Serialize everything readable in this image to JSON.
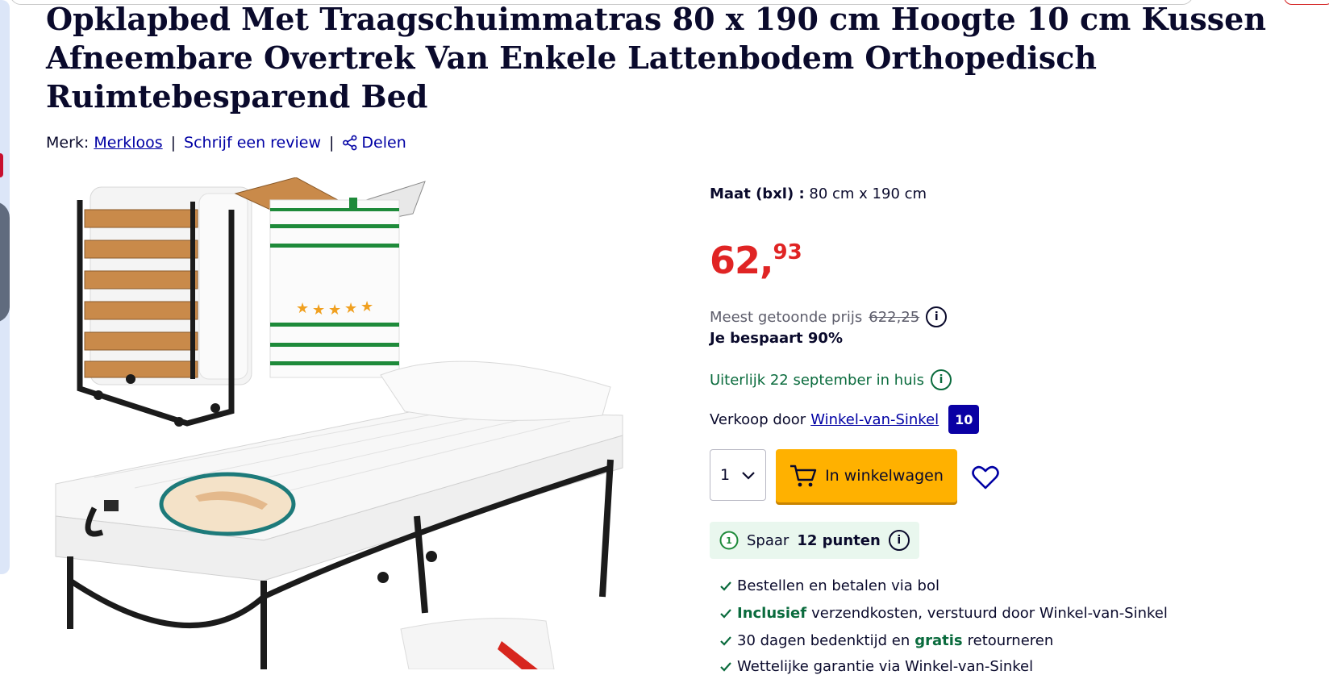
{
  "product": {
    "title": "Opklapbed Met Traagschuimmatras 80 x 190 cm Hoogte 10 cm Kussen Afneembare Overtrek Van Enkele Lattenbodem Orthopedisch Ruimtebesparend Bed",
    "brand_label": "Merk:",
    "brand": "Merkloos",
    "review_link": "Schrijf een review",
    "share_link": "Delen"
  },
  "options": {
    "size_label": "Maat (bxl) :",
    "size_value": "80 cm x 190 cm"
  },
  "price": {
    "main": "62,",
    "cents": "93",
    "reference_label": "Meest getoonde prijs",
    "reference_value": "622,25",
    "saving": "Je bespaart 90%"
  },
  "delivery": {
    "text": "Uiterlijk 22 september in huis"
  },
  "seller": {
    "label": "Verkoop door",
    "name": "Winkel-van-Sinkel",
    "score": "10"
  },
  "buy": {
    "quantity": "1",
    "cart_button": "In winkelwagen"
  },
  "points": {
    "prefix": "Spaar",
    "value": "12 punten"
  },
  "usps": {
    "line1": "Bestellen en betalen via bol",
    "line2_bold": "Inclusief",
    "line2_rest": "verzendkosten, verstuurd door Winkel-van-Sinkel",
    "line3_pre": "30 dagen bedenktijd en",
    "line3_bold": "gratis",
    "line3_post": "retourneren",
    "line4": "Wettelijke garantie via Winkel-van-Sinkel"
  },
  "colors": {
    "price_red": "#e02424",
    "link_blue": "#0000a4",
    "cart_yellow": "#ffb100",
    "green": "#0a6b3d"
  },
  "icons": [
    "share-icon",
    "info-icon",
    "chevron-down-icon",
    "cart-icon",
    "heart-icon",
    "points-badge-icon",
    "check-icon"
  ]
}
